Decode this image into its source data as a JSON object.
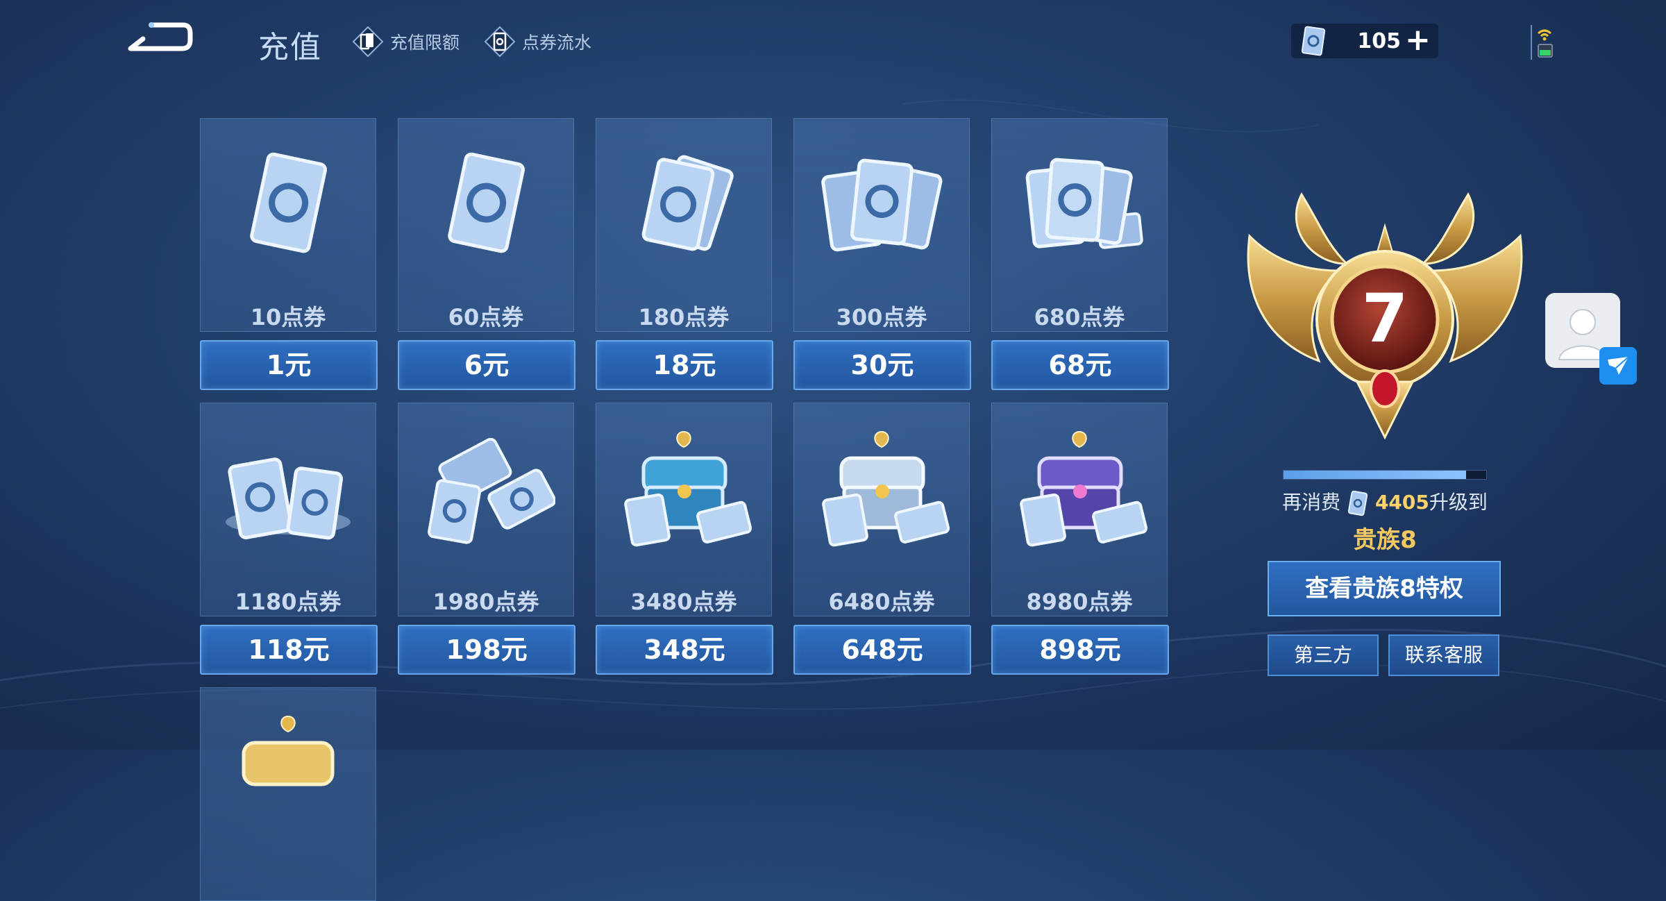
{
  "header": {
    "title": "充值",
    "links": [
      {
        "label": "充值限额",
        "icon": "cards-icon"
      },
      {
        "label": "点券流水",
        "icon": "coupon-flow-icon"
      }
    ],
    "currency": {
      "amount": "105",
      "plus_label": "+"
    }
  },
  "grid": {
    "items": [
      {
        "points": "10点券",
        "price": "1元",
        "art": "single-coupon"
      },
      {
        "points": "60点券",
        "price": "6元",
        "art": "single-coupon"
      },
      {
        "points": "180点券",
        "price": "18元",
        "art": "double-coupon"
      },
      {
        "points": "300点券",
        "price": "30元",
        "art": "triple-coupon"
      },
      {
        "points": "680点券",
        "price": "68元",
        "art": "coupon-fan"
      },
      {
        "points": "1180点券",
        "price": "118元",
        "art": "coupon-pile"
      },
      {
        "points": "1980点券",
        "price": "198元",
        "art": "coupon-stack"
      },
      {
        "points": "3480点券",
        "price": "348元",
        "art": "chest-cyan"
      },
      {
        "points": "6480点券",
        "price": "648元",
        "art": "chest-silver"
      },
      {
        "points": "8980点券",
        "price": "898元",
        "art": "chest-purple"
      },
      {
        "points": "",
        "price": "",
        "art": "chest-gold"
      }
    ]
  },
  "noble": {
    "badge_level": "7",
    "progress_fraction": 0.9,
    "upgrade_prefix": "再消费",
    "upgrade_amount": "4405",
    "upgrade_suffix": "升级到",
    "next_level": "贵族8",
    "view_button": "查看贵族8特权",
    "third_party": "第三方",
    "contact": "联系客服"
  },
  "colors": {
    "price_button": "#2a63b0",
    "gold_text": "#f3c861",
    "amount_text": "#ffd36a"
  }
}
